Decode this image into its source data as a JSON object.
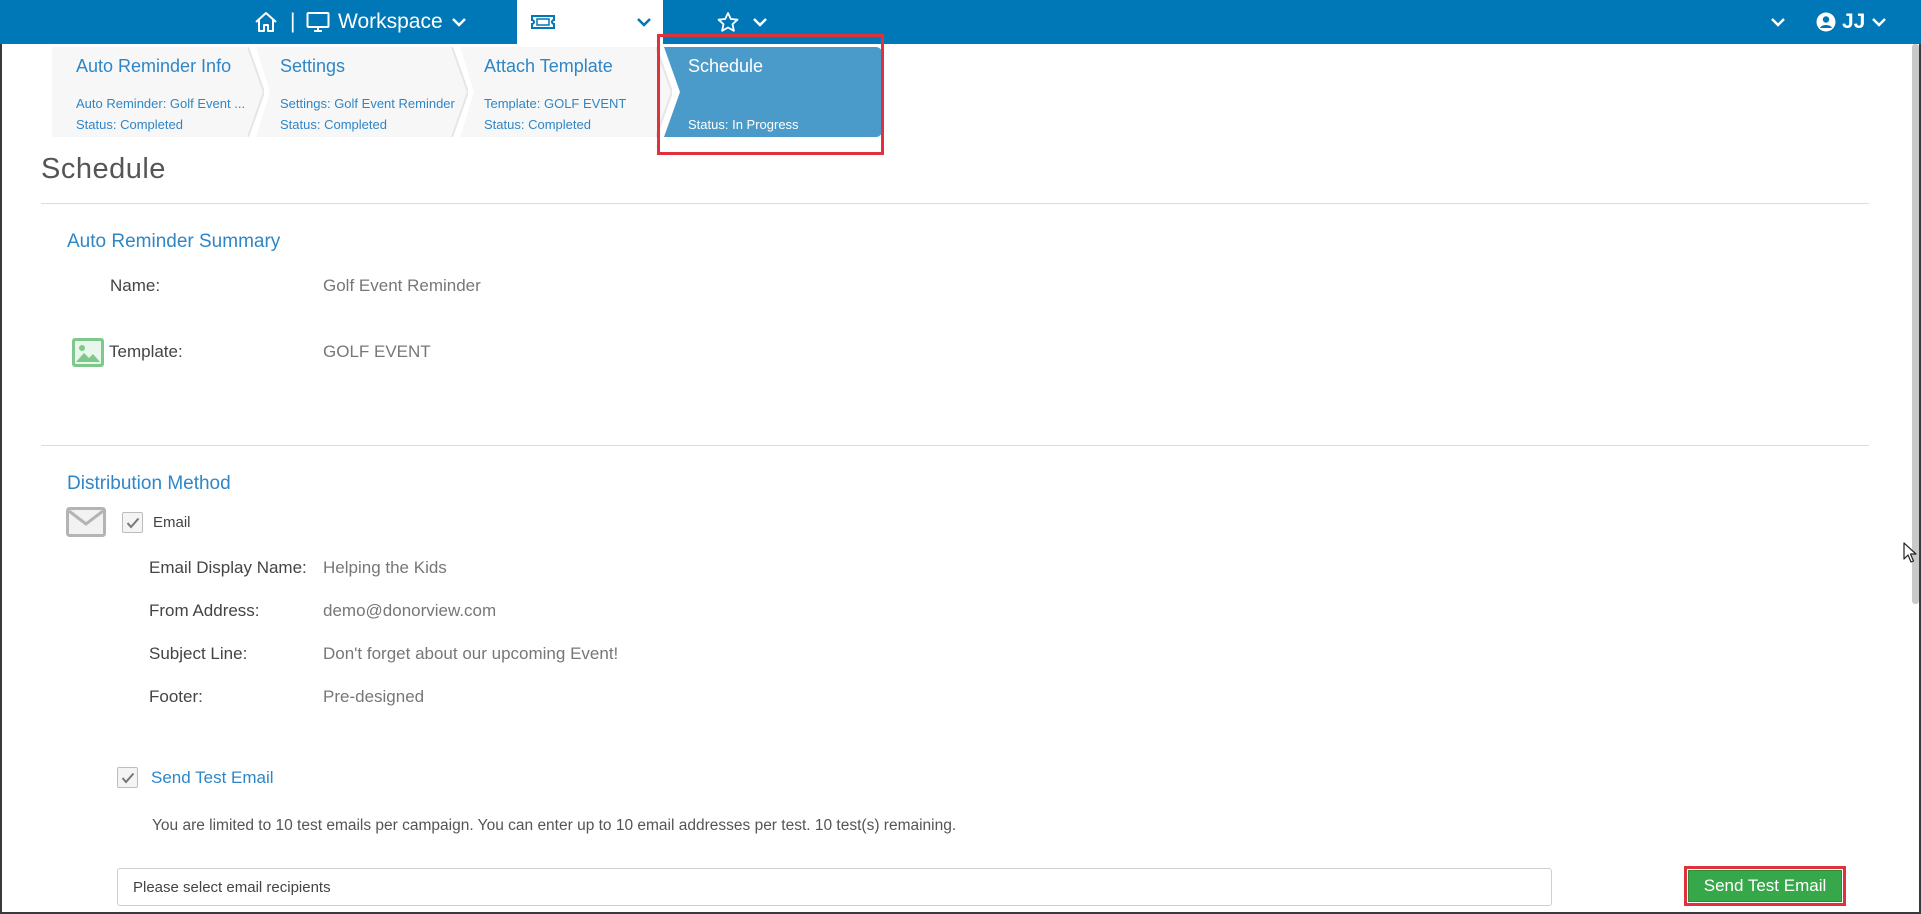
{
  "topbar": {
    "separator": "|",
    "workspace_label": "Workspace",
    "events_label": "Events",
    "user_initials": "JJ"
  },
  "wizard": {
    "steps": [
      {
        "title": "Auto Reminder Info",
        "line1": "Auto Reminder: Golf Event ...",
        "line2": "Status: Completed"
      },
      {
        "title": "Settings",
        "line1": "Settings: Golf Event Reminder",
        "line2": "Status: Completed"
      },
      {
        "title": "Attach Template",
        "line1": "Template: GOLF EVENT",
        "line2": "Status: Completed"
      },
      {
        "title": "Schedule",
        "line1": "",
        "line2": "Status: In Progress"
      }
    ]
  },
  "page": {
    "title": "Schedule"
  },
  "summary": {
    "heading": "Auto Reminder Summary",
    "name_label": "Name:",
    "name_value": "Golf Event Reminder",
    "template_label": "Template:",
    "template_value": "GOLF EVENT"
  },
  "distribution": {
    "heading": "Distribution Method",
    "email_label": "Email",
    "display_name_label": "Email Display Name:",
    "display_name_value": "Helping the Kids",
    "from_label": "From Address:",
    "from_value": "demo@donorview.com",
    "subject_label": "Subject Line:",
    "subject_value": "Don't forget about our upcoming Event!",
    "footer_label": "Footer:",
    "footer_value": "Pre-designed"
  },
  "test_email": {
    "label": "Send Test Email",
    "note": "You are limited to 10 test emails per campaign. You can enter up to 10 email addresses per test. 10 test(s) remaining.",
    "recipients_placeholder": "Please select email recipients",
    "send_button": "Send Test Email"
  },
  "colors": {
    "brand_blue": "#0077b6",
    "link_blue": "#2f86c7",
    "active_step": "#4a9bc9",
    "send_green": "#37a84a",
    "highlight_red": "#e0323c"
  }
}
